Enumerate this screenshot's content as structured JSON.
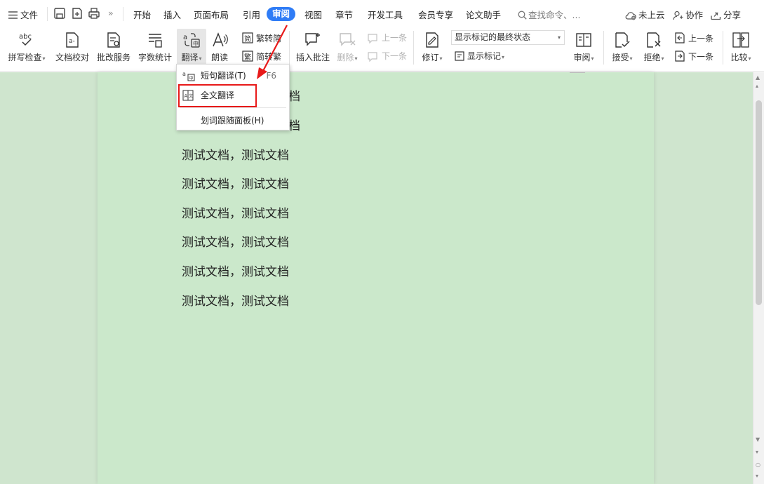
{
  "menubar": {
    "file": "文件",
    "more": "»",
    "tabs": [
      "开始",
      "插入",
      "页面布局",
      "引用",
      "审阅",
      "视图",
      "章节",
      "开发工具",
      "会员专享",
      "论文助手"
    ],
    "active_tab": "审阅",
    "search_placeholder": "查找命令、...",
    "cloud": "未上云",
    "collab": "协作",
    "share": "分享"
  },
  "ribbon": {
    "spell_check": "拼写检查",
    "doc_check": "文档校对",
    "revise_service": "批改服务",
    "word_count": "字数统计",
    "translate": "翻译",
    "read_aloud": "朗读",
    "trad_to_simp": "繁转简",
    "simp_to_trad": "简转繁",
    "insert_comment": "插入批注",
    "delete": "删除",
    "prev_comment": "上一条",
    "next_comment": "下一条",
    "track_changes": "修订",
    "display_state": "显示标记的最终状态",
    "show_markup": "显示标记",
    "review": "审阅",
    "accept": "接受",
    "reject": "拒绝",
    "prev_change": "上一条",
    "next_change": "下一条",
    "compare": "比较"
  },
  "dropdown": {
    "items": [
      {
        "label": "短句翻译(T)",
        "shortcut": "F6"
      },
      {
        "label": "全文翻译",
        "shortcut": ""
      },
      {
        "label": "划词跟随面板(H)",
        "shortcut": ""
      }
    ]
  },
  "document": {
    "partial_lines": [
      "档",
      "档"
    ],
    "lines": [
      "测试文档，测试文档",
      "测试文档，测试文档",
      "测试文档，测试文档",
      "测试文档，测试文档",
      "测试文档，测试文档",
      "测试文档，测试文档"
    ]
  },
  "colors": {
    "accent": "#2f7cf6",
    "highlight": "#e81919",
    "doc_background": "#cbe8cb"
  }
}
